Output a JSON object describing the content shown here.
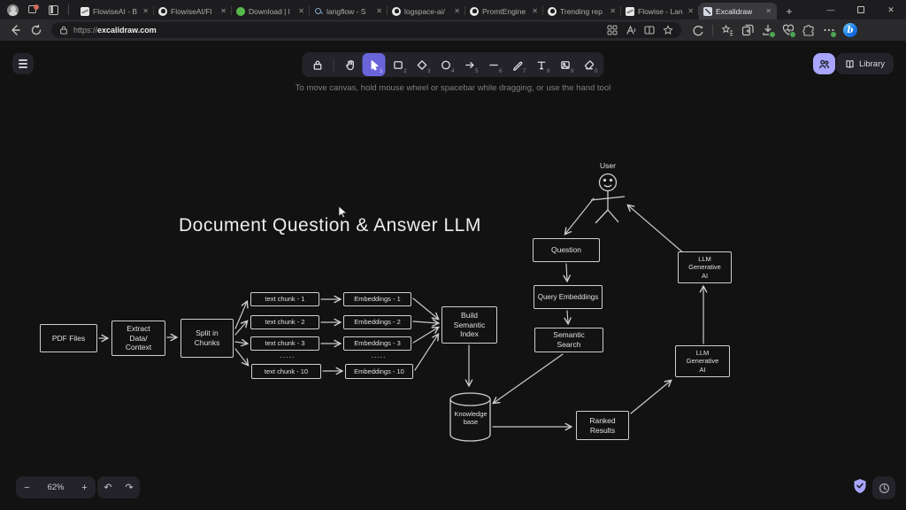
{
  "browser": {
    "tabs": [
      {
        "label": "FlowiseAI - B",
        "favicon": "flowise"
      },
      {
        "label": "FlowiseAI/Fl",
        "favicon": "github"
      },
      {
        "label": "Download | l",
        "favicon": "green"
      },
      {
        "label": "langflow - S",
        "favicon": "search"
      },
      {
        "label": "logspace-ai/",
        "favicon": "github"
      },
      {
        "label": "PromtEngine",
        "favicon": "github"
      },
      {
        "label": "Trending rep",
        "favicon": "github"
      },
      {
        "label": "Flowise - Lan",
        "favicon": "flowise"
      },
      {
        "label": "Excalidraw",
        "favicon": "excalidraw"
      }
    ],
    "tab_close_glyph": "✕",
    "new_tab_glyph": "+",
    "window": {
      "minimize_glyph": "—",
      "close_glyph": "✕"
    },
    "address": {
      "scheme": "https://",
      "host": "excalidraw.com"
    },
    "toolbar_icon_names": [
      "back-icon",
      "refresh-icon",
      "lock-icon",
      "apps-grid-icon",
      "read-aloud-icon",
      "split-screen-icon",
      "favorite-star-icon",
      "rewards-icon",
      "favorites-bar-icon",
      "collections-icon",
      "downloads-icon",
      "browser-essentials-icon",
      "extensions-icon",
      "settings-more-icon",
      "copilot-icon"
    ],
    "copilot_glyph": "b"
  },
  "excalidraw": {
    "tools": [
      {
        "name": "lock",
        "key": ""
      },
      {
        "name": "hand",
        "key": ""
      },
      {
        "name": "selection",
        "key": "1",
        "active": true
      },
      {
        "name": "rectangle",
        "key": "2"
      },
      {
        "name": "diamond",
        "key": "3"
      },
      {
        "name": "ellipse",
        "key": "4"
      },
      {
        "name": "arrow",
        "key": "5"
      },
      {
        "name": "line",
        "key": "6"
      },
      {
        "name": "draw",
        "key": "7"
      },
      {
        "name": "text",
        "key": "8"
      },
      {
        "name": "image",
        "key": "9"
      },
      {
        "name": "eraser",
        "key": "0"
      }
    ],
    "library_label": "Library",
    "hint": "To move canvas, hold mouse wheel or spacebar while dragging, or use the hand tool",
    "zoom_out_glyph": "−",
    "zoom_level": "62%",
    "zoom_in_glyph": "+",
    "undo_glyph": "↶",
    "redo_glyph": "↷"
  },
  "colors": {
    "accent_purple": "#a8a5ff",
    "active_tool_purple": "#6a64d9",
    "canvas_bg": "#121212",
    "island_bg": "#232329",
    "diagram_stroke": "#cfcfcf",
    "badge_green": "#4ca654"
  },
  "diagram": {
    "title": "Document Question & Answer LLM",
    "nodes": {
      "user": "User",
      "pdf_files": "PDF Files",
      "extract": "Extract\nData/\nContext",
      "split": "Split in\nChunks",
      "chunk_1": "text chunk - 1",
      "chunk_2": "text chunk - 2",
      "chunk_3": "text chunk - 3",
      "chunk_dots": ".....",
      "chunk_10": "text chunk - 10",
      "emb_1": "Embeddings - 1",
      "emb_2": "Embeddings  - 2",
      "emb_3": "Embeddings  - 3",
      "emb_dots": ".....",
      "emb_10": "Embeddings  - 10",
      "build_index": "Build\nSemantic\nIndex",
      "question": "Question",
      "query_embeddings": "Query Embeddings",
      "semantic_search": "Semantic\nSearch",
      "llm_generative_top": "LLM\nGenerative\nAI",
      "llm_generative_bottom": "LLM\nGenerative\nAI",
      "knowledge_base": "Knowledge\nbase",
      "ranked_results": "Ranked\nResults"
    }
  }
}
